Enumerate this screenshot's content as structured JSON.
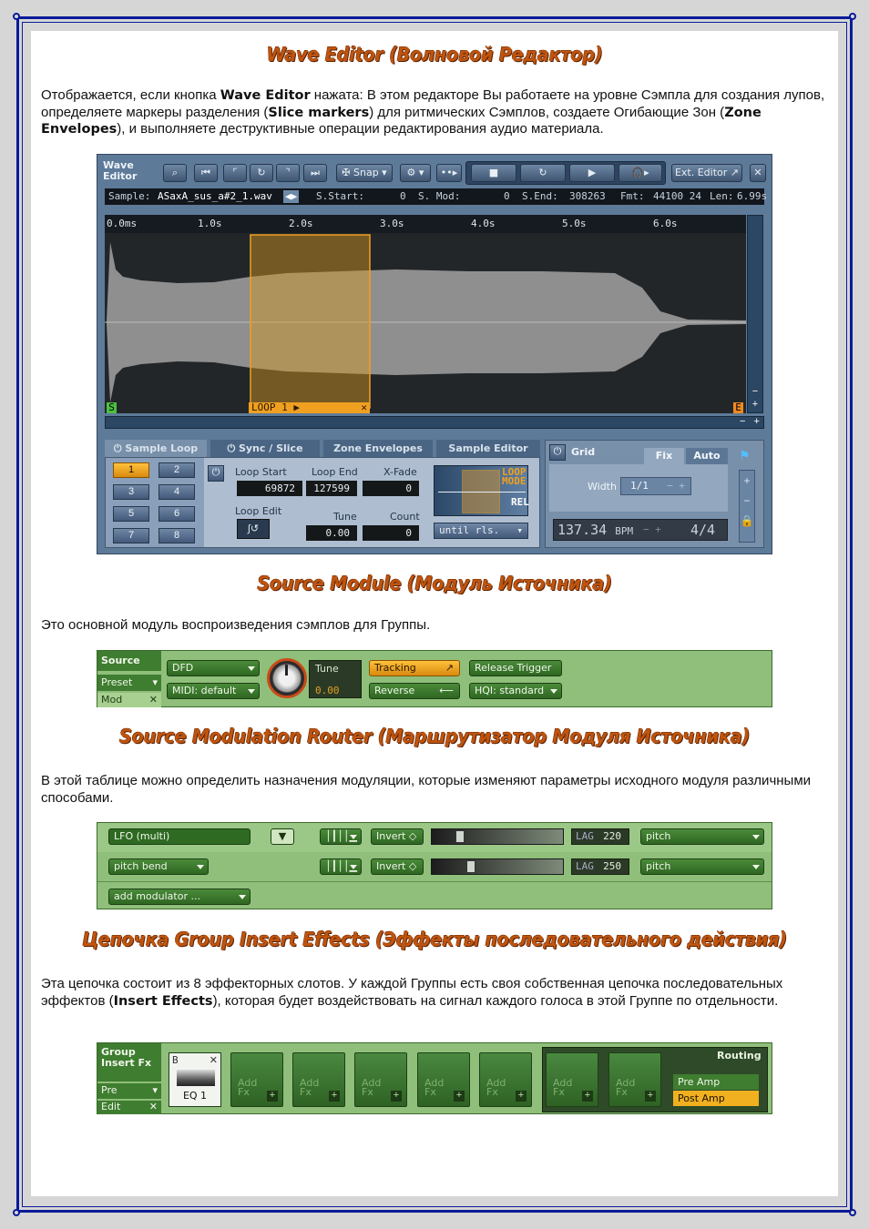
{
  "sections": {
    "wave_editor": {
      "heading": "Wave Editor (Волновой Редактор)",
      "para_1": "Отображается, если кнопка ",
      "bold_1": "Wave Editor",
      "para_2": " нажата: В этом редакторе Вы работаете на уровне Сэмпла для создания лупов, определяете маркеры разделения (",
      "bold_2": "Slice markers",
      "para_3": ") для ритмических Сэмплов, создаете Огибающие Зон (",
      "bold_3": "Zone Envelopes",
      "para_4": "), и выполняете деструктивные операции редактирования аудио материала."
    },
    "source_module": {
      "heading": "Source Module (Модуль Источника)",
      "para": "Это основной модуль воспроизведения сэмплов для Группы."
    },
    "source_router": {
      "heading": "Source Modulation Router (Маршрутизатор Модуля Источника)",
      "para": "В этой таблице можно определить назначения модуляции, которые изменяют параметры исходного модуля различными способами."
    },
    "insert_fx": {
      "heading": "Цепочка Group Insert Effects (Эффекты последовательного действия)",
      "para_1": " Эта цепочка состоит из 8 эффекторных слотов. У каждой Группы есть своя собственная цепочка последовательных эффектов (",
      "bold_1": "Insert Effects",
      "para_2": "), которая будет воздействовать на сигнал каждого голоса в этой Группе по отдельности."
    }
  },
  "wave_editor_ui": {
    "title_1": "Wave",
    "title_2": "Editor",
    "snap_label": "Snap",
    "ext_editor_label": "Ext. Editor",
    "info": {
      "sample_label": "Sample:",
      "sample_name": "ASaxA_sus_a#2_1.wav",
      "sstart_label": "S.Start:",
      "sstart_value": "0",
      "smod_label": "S. Mod:",
      "smod_value": "0",
      "send_label": "S.End:",
      "send_value": "308263",
      "fmt_label": "Fmt:",
      "fmt_value": "44100  24",
      "len_label": "Len:",
      "len_value": "6.99s"
    },
    "ruler_ticks": [
      "0.0ms",
      "1.0s",
      "2.0s",
      "3.0s",
      "4.0s",
      "5.0s",
      "6.0s"
    ],
    "loop_marker_label": "LOOP 1",
    "start_marker": "S",
    "end_marker": "E",
    "tabs": [
      "Sample Loop",
      "Sync / Slice",
      "Zone Envelopes",
      "Sample Editor"
    ],
    "loop_buttons": [
      "1",
      "2",
      "3",
      "4",
      "5",
      "6",
      "7",
      "8"
    ],
    "loop_start_label": "Loop Start",
    "loop_start_value": "69872",
    "loop_end_label": "Loop End",
    "loop_end_value": "127599",
    "xfade_label": "X-Fade",
    "xfade_value": "0",
    "loop_edit_label": "Loop Edit",
    "tune_label": "Tune",
    "tune_value": "0.00",
    "count_label": "Count",
    "count_value": "0",
    "loop_mode_label_1": "LOOP",
    "loop_mode_label_2": "MODE",
    "loop_mode_rel": "REL",
    "until_label": "until rls.",
    "grid_label": "Grid",
    "fix_label": "Fix",
    "auto_label": "Auto",
    "width_label": "Width",
    "width_value": "1/1",
    "bpm_value": "137.34",
    "bpm_unit": "BPM",
    "time_sig": "4/4"
  },
  "source_ui": {
    "title": "Source",
    "preset": "Preset",
    "mod": "Mod",
    "mode": "DFD",
    "midi": "MIDI: default",
    "tune_label": "Tune",
    "tune_value": "0.00",
    "tracking": "Tracking",
    "reverse": "Reverse",
    "release_trigger": "Release Trigger",
    "hqi": "HQI: standard"
  },
  "router_ui": {
    "rows": [
      {
        "source": "LFO (multi)",
        "invert": "Invert",
        "lag_label": "LAG",
        "lag_value": "220",
        "target": "pitch"
      },
      {
        "source": "pitch bend",
        "invert": "Invert",
        "lag_label": "LAG",
        "lag_value": "250",
        "target": "pitch"
      }
    ],
    "add_modulator": "add modulator ..."
  },
  "fx_ui": {
    "title_1": "Group",
    "title_2": "Insert Fx",
    "preset": "Pre",
    "edit": "Edit",
    "eq_label": "EQ 1",
    "eq_b": "B",
    "add_1": "Add",
    "add_2": "Fx",
    "routing": "Routing",
    "pre_amp": "Pre Amp",
    "post_amp": "Post Amp"
  },
  "colors": {
    "heading": "#c0540e",
    "frame": "#0a1a9a",
    "kontakt_blue": "#5e7a99",
    "kontakt_green": "#8fbf7a",
    "loop_orange": "#f0a020"
  }
}
